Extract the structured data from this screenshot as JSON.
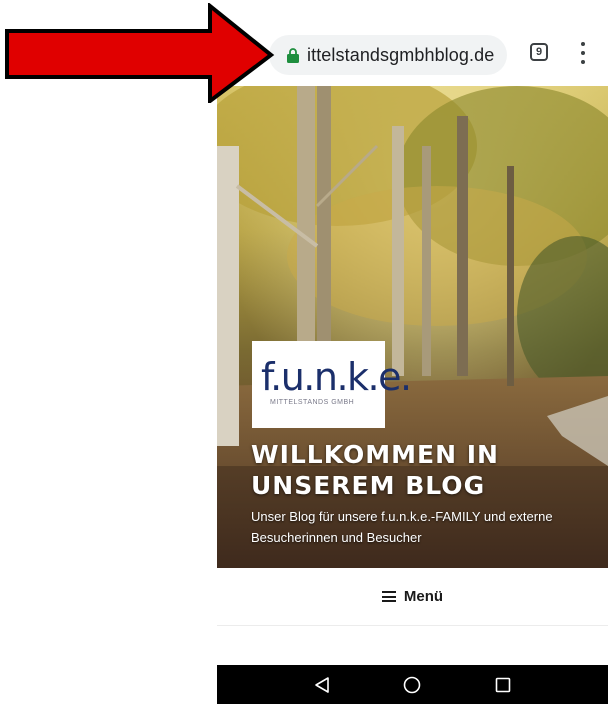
{
  "annotation": {
    "arrow_color": "#e00000",
    "arrow_icon": "arrow-right-icon"
  },
  "browser": {
    "url": "ittelstandsgmbhblog.de",
    "tab_count": "9",
    "lock_icon": "lock-icon",
    "lock_color": "#1e8e3e",
    "menu_icon": "more-vert-icon"
  },
  "hero": {
    "logo_text": "f.u.n.k.e.",
    "logo_subtext": "MITTELSTANDS GMBH",
    "logo_color": "#1b2f6b",
    "title": "WILLKOMMEN IN UNSEREM BLOG",
    "tagline": "Unser Blog für unsere f.u.n.k.e.-FAMILY und externe Besucherinnen und Besucher"
  },
  "nav": {
    "menu_label": "Menü",
    "menu_icon": "hamburger-icon"
  },
  "system_nav": {
    "back_icon": "back-icon",
    "home_icon": "home-icon",
    "recents_icon": "recents-icon"
  }
}
